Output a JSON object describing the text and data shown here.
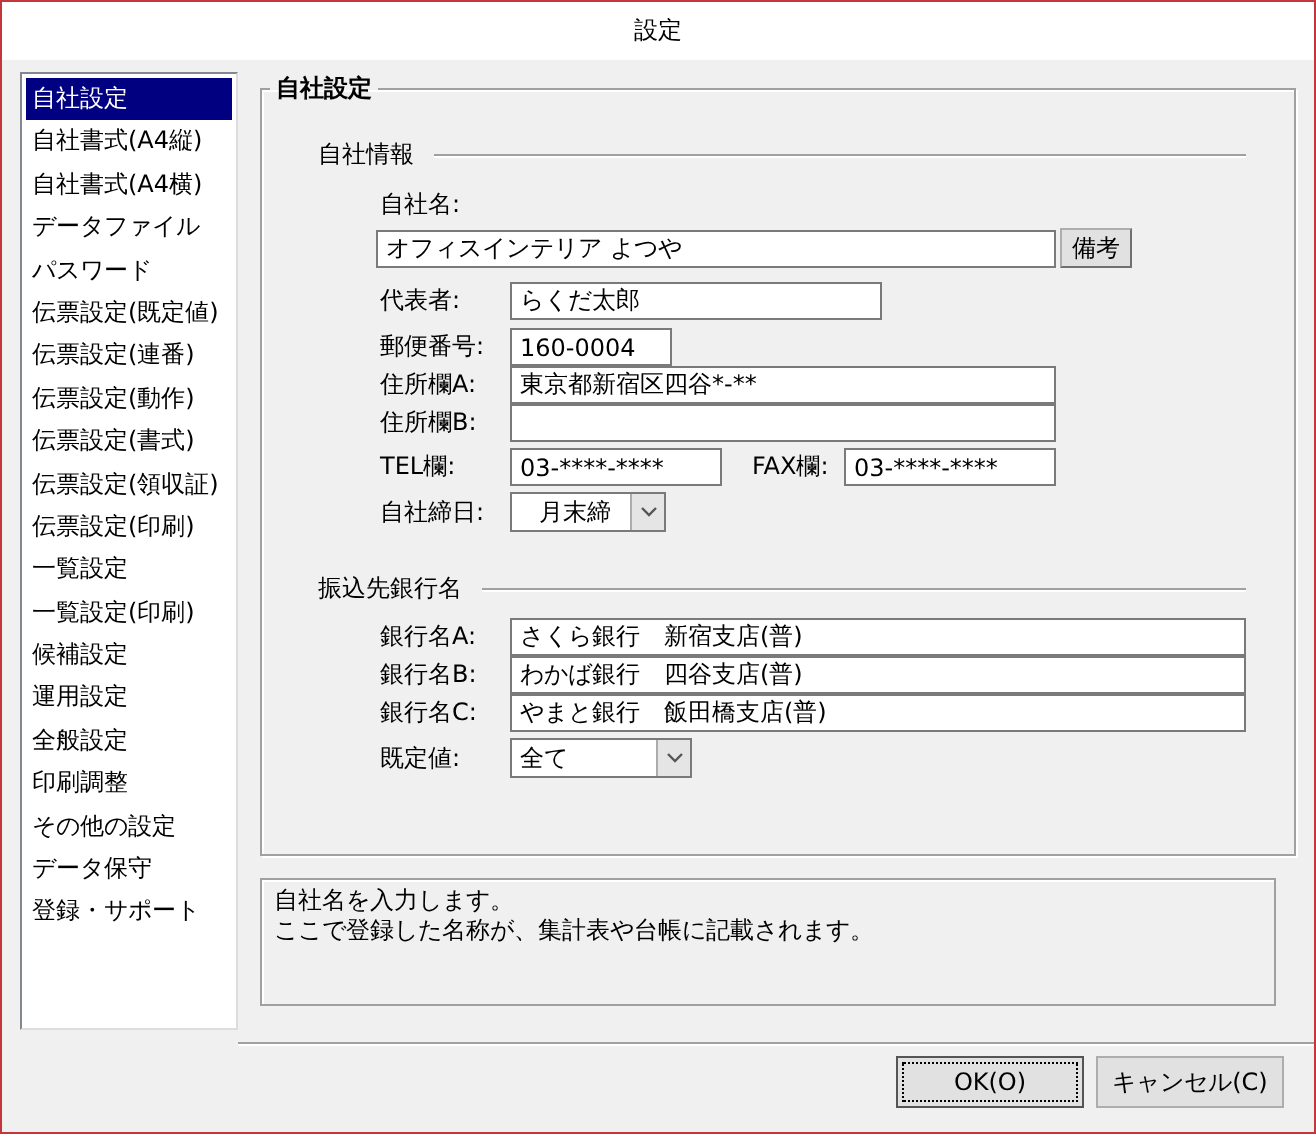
{
  "window": {
    "title": "設定"
  },
  "sidebar": {
    "items": [
      {
        "label": "自社設定",
        "selected": true
      },
      {
        "label": "自社書式(A4縦)",
        "selected": false
      },
      {
        "label": "自社書式(A4横)",
        "selected": false
      },
      {
        "label": "データファイル",
        "selected": false
      },
      {
        "label": "パスワード",
        "selected": false
      },
      {
        "label": "伝票設定(既定値)",
        "selected": false
      },
      {
        "label": "伝票設定(連番)",
        "selected": false
      },
      {
        "label": "伝票設定(動作)",
        "selected": false
      },
      {
        "label": "伝票設定(書式)",
        "selected": false
      },
      {
        "label": "伝票設定(領収証)",
        "selected": false
      },
      {
        "label": "伝票設定(印刷)",
        "selected": false
      },
      {
        "label": "一覧設定",
        "selected": false
      },
      {
        "label": "一覧設定(印刷)",
        "selected": false
      },
      {
        "label": "候補設定",
        "selected": false
      },
      {
        "label": "運用設定",
        "selected": false
      },
      {
        "label": "全般設定",
        "selected": false
      },
      {
        "label": "印刷調整",
        "selected": false
      },
      {
        "label": "その他の設定",
        "selected": false
      },
      {
        "label": "データ保守",
        "selected": false
      },
      {
        "label": "登録・サポート",
        "selected": false
      }
    ]
  },
  "panel": {
    "title": "自社設定",
    "company_info": {
      "heading": "自社情報",
      "name_label": "自社名:",
      "name_value": "オフィスインテリア よつや",
      "memo_button": "備考",
      "rows": [
        {
          "kind": "text",
          "label": "代表者:",
          "value": "らくだ太郎"
        },
        {
          "kind": "text",
          "label": "郵便番号:",
          "value": "160-0004"
        },
        {
          "kind": "text",
          "label": "住所欄A:",
          "value": "東京都新宿区四谷*-**"
        },
        {
          "kind": "text",
          "label": "住所欄B:"
        },
        {
          "kind": "pair",
          "label": "TEL欄:",
          "value": "03-****-****",
          "label_2": "FAX欄:",
          "value_2": "03-****-****"
        },
        {
          "kind": "select",
          "label": "自社締日:",
          "value": "月末締"
        }
      ]
    },
    "bank": {
      "heading": "振込先銀行名",
      "rows": [
        {
          "kind": "text",
          "label": "銀行名A:",
          "value": "さくら銀行　新宿支店(普)"
        },
        {
          "kind": "text",
          "label": "銀行名B:",
          "value": "わかば銀行　四谷支店(普)"
        },
        {
          "kind": "text",
          "label": "銀行名C:",
          "value": "やまと銀行　飯田橋支店(普)"
        },
        {
          "kind": "select",
          "label": "既定値:",
          "value": "全て"
        }
      ]
    }
  },
  "description": [
    "自社名を入力します。",
    "ここで登録した名称が、集計表や台帳に記載されます。"
  ],
  "buttons": [
    "OK(O)",
    "キャンセル(C)"
  ]
}
